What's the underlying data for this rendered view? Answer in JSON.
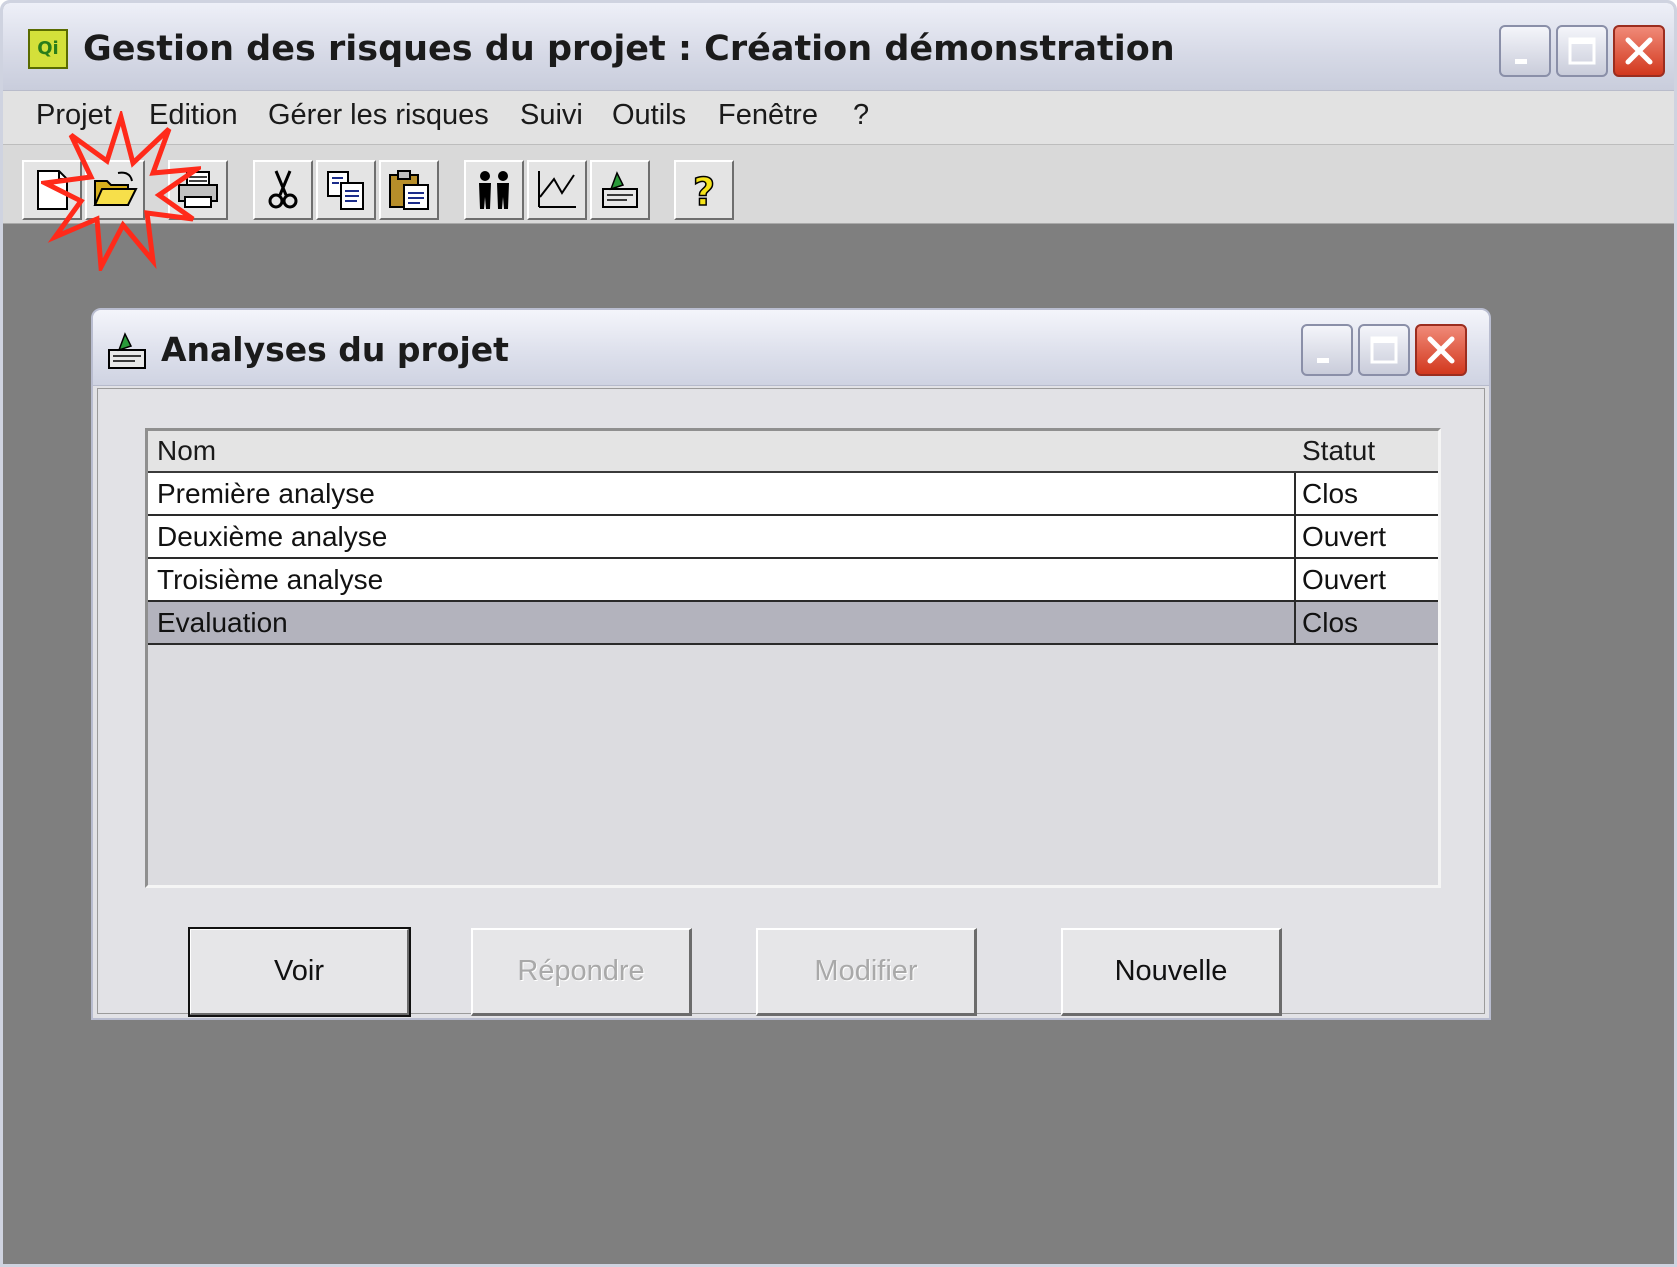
{
  "main_window": {
    "title": "Gestion des risques du projet : Création démonstration",
    "app_icon": "app-logo-icon"
  },
  "menubar": {
    "items": [
      "Projet",
      "Edition",
      "Gérer les risques",
      "Suivi",
      "Outils",
      "Fenêtre",
      "?"
    ]
  },
  "toolbar": {
    "buttons": [
      "new-document-icon",
      "open-folder-icon",
      "print-icon",
      "cut-icon",
      "copy-icon",
      "paste-icon",
      "people-icon",
      "chart-icon",
      "analyses-icon",
      "help-icon"
    ]
  },
  "child_window": {
    "title": "Analyses du projet",
    "list": {
      "columns": [
        "Nom",
        "Statut"
      ],
      "rows": [
        {
          "nom": "Première analyse",
          "statut": "Clos"
        },
        {
          "nom": "Deuxième analyse",
          "statut": "Ouvert"
        },
        {
          "nom": "Troisième analyse",
          "statut": "Ouvert"
        },
        {
          "nom": "Evaluation",
          "statut": "Clos",
          "selected": true
        }
      ]
    },
    "buttons": {
      "voir": "Voir",
      "repondre": "Répondre",
      "modifier": "Modifier",
      "nouvelle": "Nouvelle"
    }
  },
  "colors": {
    "desktop": "#7f7f7f",
    "selection": "#b3b3bd",
    "close_button": "#d2381e",
    "highlight_burst": "#ff2a1a"
  }
}
